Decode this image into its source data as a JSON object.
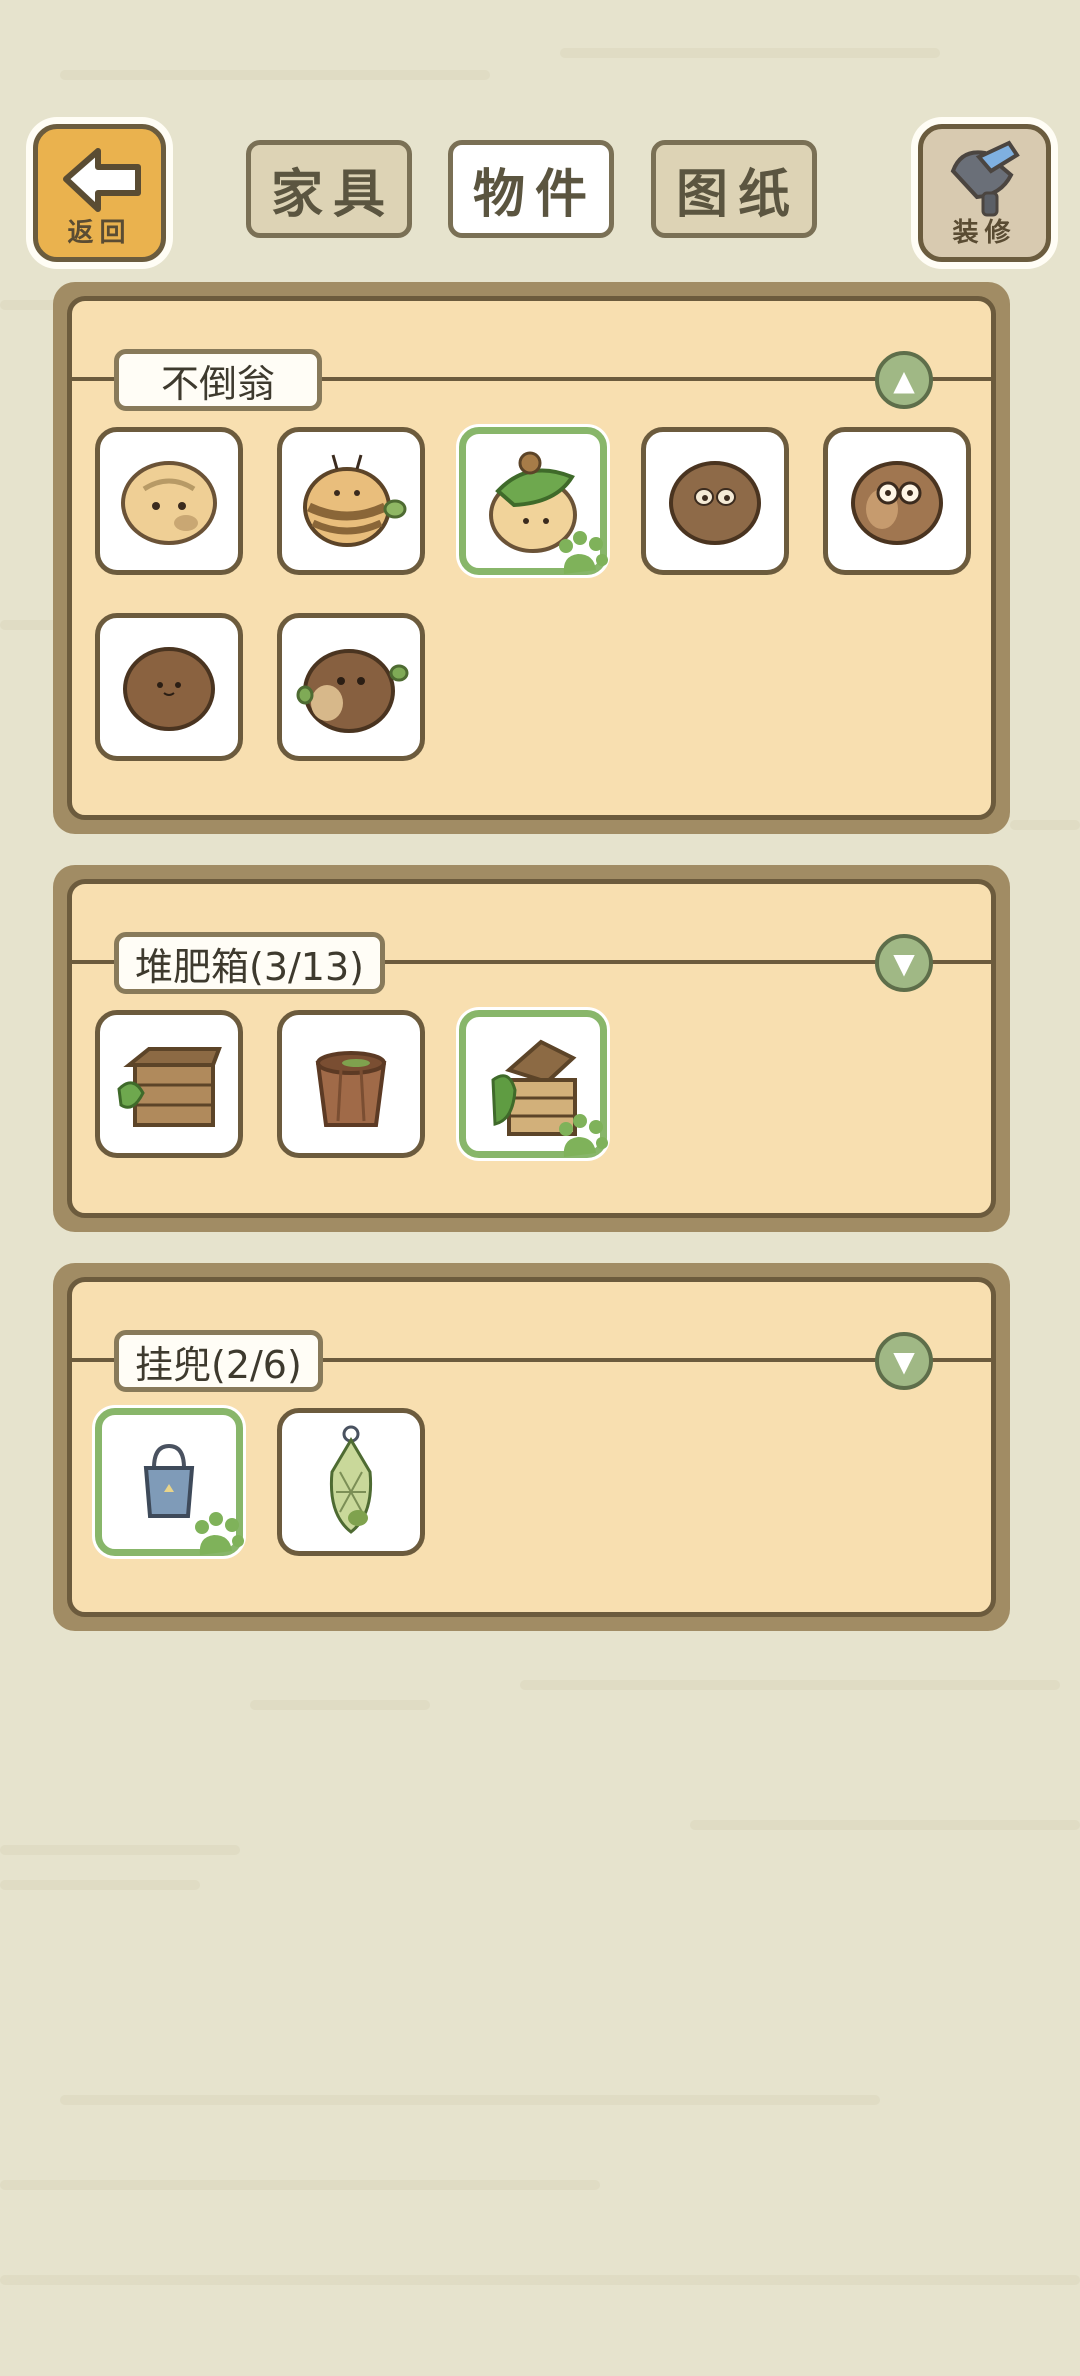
{
  "header": {
    "back_label": "返回",
    "decorate_label": "装修",
    "tabs": [
      {
        "label": "家具",
        "active": false
      },
      {
        "label": "物件",
        "active": true
      },
      {
        "label": "图纸",
        "active": false
      }
    ]
  },
  "sections": [
    {
      "title": "不倒翁",
      "expanded": true,
      "items": [
        "daruma-plain",
        "daruma-bee",
        "daruma-leaf-hat",
        "daruma-brown-face",
        "daruma-owl",
        "daruma-brown",
        "daruma-sprout"
      ],
      "selected_index": 2
    },
    {
      "title": "堆肥箱(3/13)",
      "expanded": false,
      "items": [
        "compost-crate",
        "compost-bucket",
        "compost-box-open"
      ],
      "selected_index": 2
    },
    {
      "title": "挂兜(2/6)",
      "expanded": false,
      "items": [
        "hanging-bag-blue",
        "hanging-net-bag"
      ],
      "selected_index": 0
    }
  ],
  "colors": {
    "background": "#e6e3cd",
    "panel_fill": "#f8dfb0",
    "panel_border": "#a18c64",
    "accent_green": "#88b66a"
  }
}
